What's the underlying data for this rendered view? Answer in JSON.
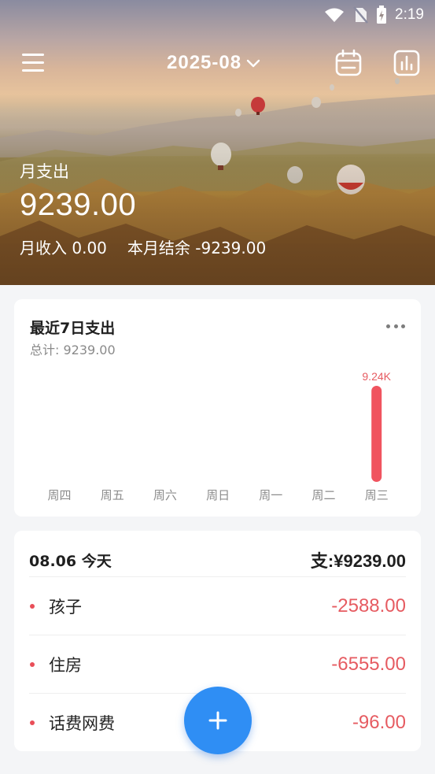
{
  "status_bar": {
    "time": "2:19",
    "icons": [
      "wifi-icon",
      "no-sim-icon",
      "battery-charging-icon"
    ]
  },
  "header": {
    "month": "2025-08",
    "icons": [
      "menu-icon",
      "chevron-down-icon",
      "calendar-icon",
      "bar-chart-icon"
    ]
  },
  "summary": {
    "expense_label": "月支出",
    "expense_value": "9239.00",
    "income_text": "月收入 0.00",
    "balance_text": "本月结余 -9239.00"
  },
  "chart_card": {
    "title": "最近7日支出",
    "total_text": "总计: 9239.00",
    "more_icon": "more-horizontal-icon"
  },
  "chart_data": {
    "type": "bar",
    "categories": [
      "周四",
      "周五",
      "周六",
      "周日",
      "周一",
      "周二",
      "周三"
    ],
    "values": [
      0,
      0,
      0,
      0,
      0,
      0,
      9239
    ],
    "data_labels": [
      "",
      "",
      "",
      "",
      "",
      "",
      "9.24K"
    ],
    "bar_color": "#f0545f",
    "title": "最近7日支出",
    "xlabel": "",
    "ylabel": ""
  },
  "day_group": {
    "date_text": "08.06 今天",
    "total_text": "支:¥9239.00",
    "entries": [
      {
        "category": "孩子",
        "amount": "-2588.00"
      },
      {
        "category": "住房",
        "amount": "-6555.00"
      },
      {
        "category": "话费网费",
        "amount": "-96.00"
      }
    ]
  },
  "fab": {
    "icon": "plus-icon"
  },
  "colors": {
    "accent": "#2f8ef4",
    "expense": "#e65b61",
    "bar": "#f0545f"
  }
}
